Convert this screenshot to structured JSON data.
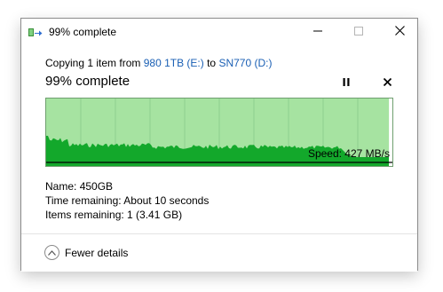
{
  "window": {
    "title": "99% complete",
    "icon": "file-copy-icon",
    "controls": [
      "minimize-icon",
      "maximize-icon",
      "close-icon"
    ]
  },
  "copy": {
    "prefix": "Copying 1 item from ",
    "source": "980 1TB (E:)",
    "mid": " to ",
    "destination": "SN770 (D:)",
    "progress_text": "99% complete",
    "progress_fraction": 0.99
  },
  "graph": {
    "speed_label": "Speed: 427 MB/s",
    "colors": {
      "background_fill": "#a6e3a1",
      "throughput_fill": "#13a82b",
      "gridline": "#8fcf8f",
      "speed_line": "#000000"
    }
  },
  "details": {
    "name_label": "Name:",
    "name_value": "450GB",
    "time_label": "Time remaining:",
    "time_value": "About 10 seconds",
    "items_label": "Items remaining:",
    "items_value": "1 (3.41 GB)"
  },
  "footer": {
    "toggle_label": "Fewer details"
  }
}
